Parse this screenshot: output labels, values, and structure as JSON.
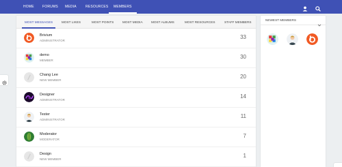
{
  "nav": {
    "items": [
      {
        "label": "HOME"
      },
      {
        "label": "FORUMS"
      },
      {
        "label": "MEDIA"
      },
      {
        "label": "RESOURCES"
      },
      {
        "label": "MEMBERS"
      }
    ],
    "active": "MEMBERS",
    "icons": [
      "user-icon",
      "search-icon"
    ]
  },
  "tabs": [
    {
      "label": "MOST MESSAGES"
    },
    {
      "label": "MOST LIKES"
    },
    {
      "label": "MOST POINTS"
    },
    {
      "label": "MOST MEDIA"
    },
    {
      "label": "MOST ALBUMS"
    },
    {
      "label": "MOST RESOURCES"
    },
    {
      "label": "STAFF MEMBERS"
    }
  ],
  "members": [
    {
      "name": "Brivium",
      "role": "ADMINISTRATOR",
      "count": "33",
      "avatar": "brivium-logo"
    },
    {
      "name": "demo",
      "role": "MEMBER",
      "count": "30",
      "avatar": "colorful-cube"
    },
    {
      "name": "Chang Lee",
      "role": "NEW MEMBER",
      "count": "20",
      "avatar": "default-avatar"
    },
    {
      "name": "Designer",
      "role": "ADMINISTRATOR",
      "count": "14",
      "avatar": "purple-art"
    },
    {
      "name": "Tester",
      "role": "ADMINISTRATOR",
      "count": "11",
      "avatar": "person-suit"
    },
    {
      "name": "Moderator",
      "role": "MODERATOR",
      "count": "7",
      "avatar": "green-leaf"
    },
    {
      "name": "Design",
      "role": "NEW MEMBER",
      "count": "1",
      "avatar": "default-avatar"
    }
  ],
  "sidebar": {
    "title": "NEWEST MEMBERS",
    "avatars": [
      "colorful-cube",
      "person-suit",
      "brivium-logo"
    ]
  },
  "colors": {
    "brand": "#3f51b5",
    "brivium": "#f15a24"
  }
}
